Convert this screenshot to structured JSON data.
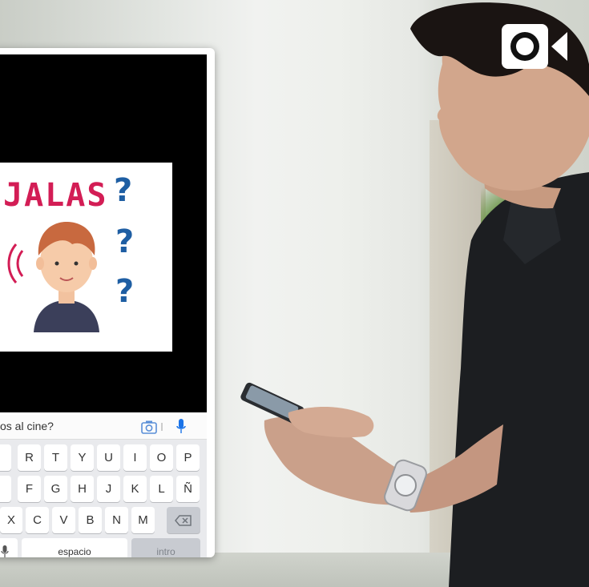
{
  "phone": {
    "illustration": {
      "title_text": "JALAS",
      "question_marks": [
        "?",
        "?",
        "?"
      ]
    },
    "input": {
      "text": "os al cine?",
      "camera_icon": "camera-icon",
      "mic_icon": "microphone-icon"
    },
    "keyboard": {
      "row1": [
        "",
        "R",
        "T",
        "Y",
        "U",
        "I",
        "O",
        "P"
      ],
      "row2": [
        "",
        "F",
        "G",
        "H",
        "J",
        "K",
        "L",
        "Ñ"
      ],
      "row3": [
        "X",
        "C",
        "V",
        "B",
        "N",
        "M"
      ],
      "backspace_icon": "backspace-icon",
      "mic_key_icon": "microphone-icon",
      "space_label": "espacio",
      "enter_label": "intro"
    }
  },
  "overlay": {
    "record_badge_icon": "record-video-icon"
  },
  "colors": {
    "title_red": "#d31d55",
    "question_blue": "#1e5ea3",
    "mic_blue": "#1a73e8",
    "keyboard_bg": "#e9eaed"
  }
}
